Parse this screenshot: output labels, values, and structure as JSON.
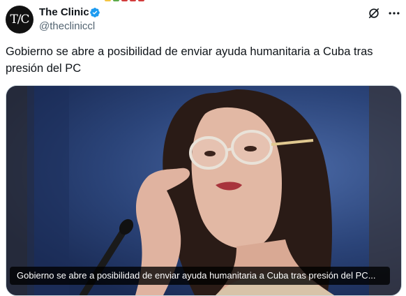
{
  "tweet": {
    "author": {
      "avatar_text": "T/C",
      "name": "The Clinic",
      "handle": "@theclinicc​l",
      "verified": true
    },
    "text": "Gobierno se abre a posibilidad de enviar ayuda humanitaria a Cuba tras presión del PC",
    "media": {
      "caption": "Gobierno se abre a posibilidad de enviar ayuda humanitaria a Cuba tras presión del PC..."
    }
  },
  "icons": {
    "verified": "verified-badge-icon",
    "grok": "grok-icon",
    "more": "more-options-icon"
  },
  "colors": {
    "verified_blue": "#1d9bf0",
    "handle_gray": "#536471",
    "text": "#0f1419"
  }
}
